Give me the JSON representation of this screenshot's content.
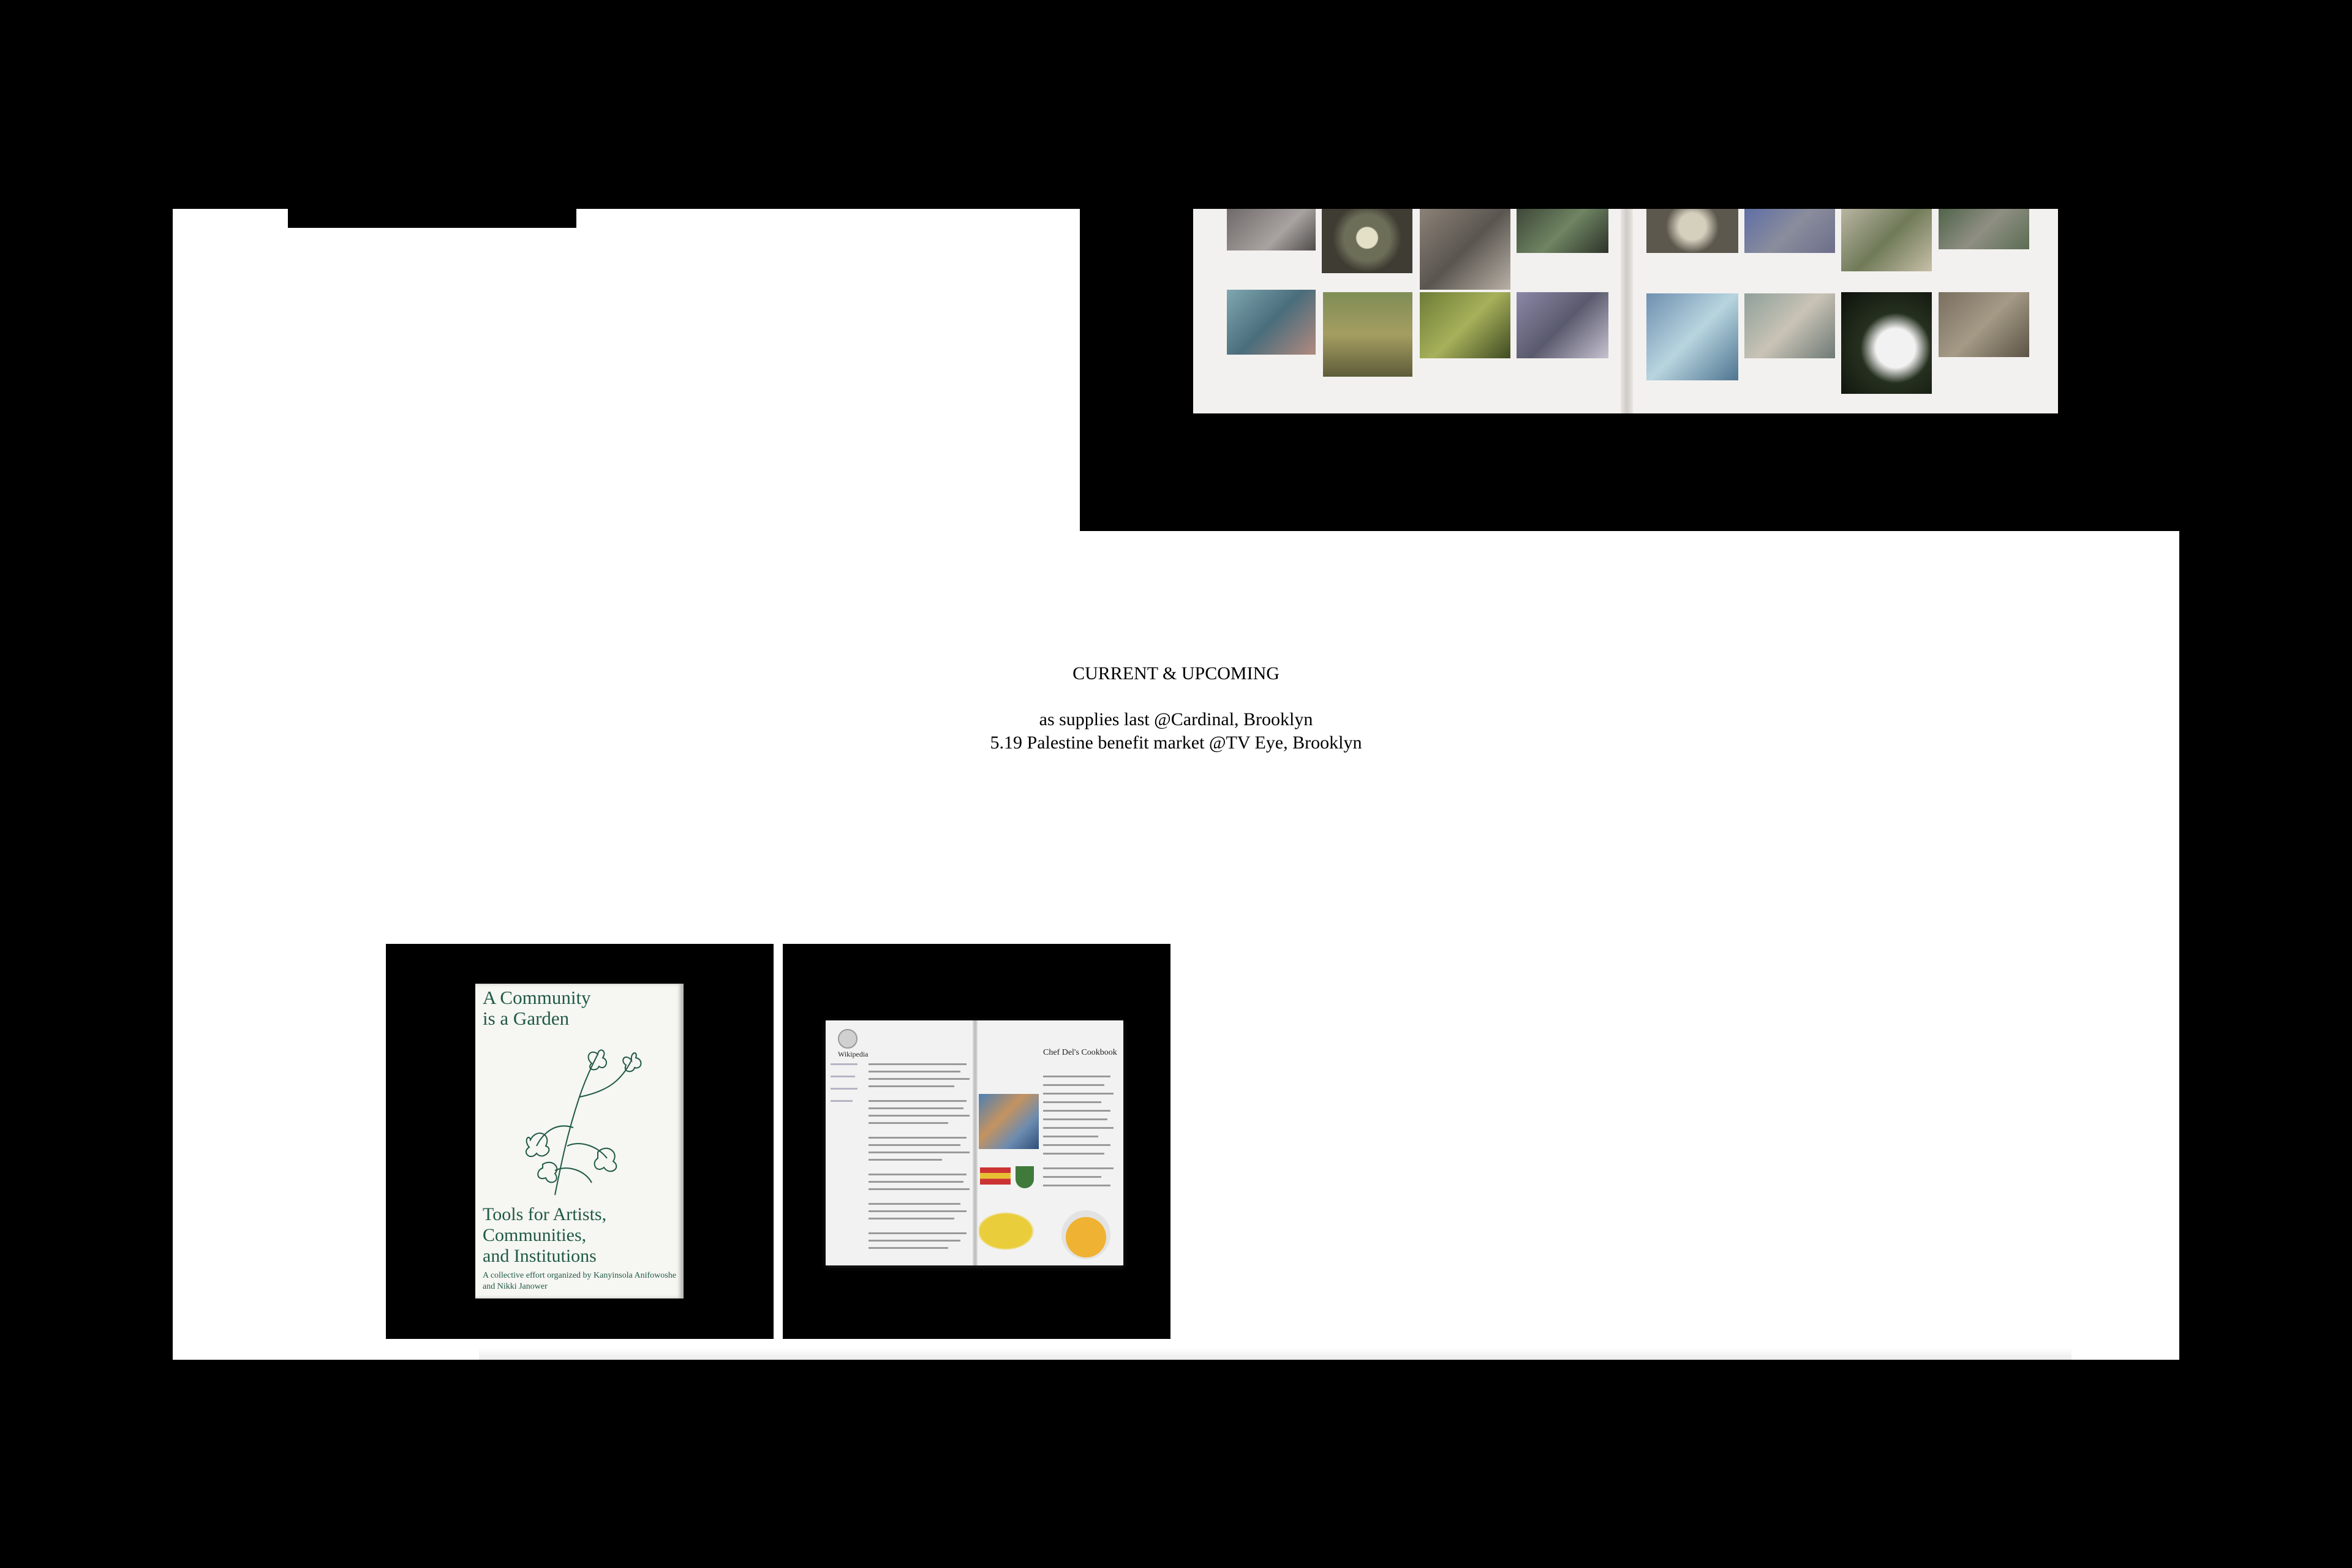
{
  "events": {
    "heading": "CURRENT & UPCOMING",
    "items": [
      "as supplies last @Cardinal, Brooklyn",
      "5.19 Palestine benefit market @TV Eye, Brooklyn"
    ]
  },
  "products": [
    {
      "image": "book-cover",
      "title_line_1": "A Community",
      "title_line_2": "is a Garden",
      "subtitle_line_1": "Tools for Artists,",
      "subtitle_line_2": "Communities,",
      "subtitle_line_3": "and Institutions",
      "credit": "A collective effort organized by Kanyinsola Anifowoshe and Nikki Janower"
    },
    {
      "image": "open-spread",
      "page_heading_left": "Wikipedia",
      "page_heading_right": "Chef Del's Cookbook"
    }
  ],
  "colors": {
    "background": "#000000",
    "page": "#ffffff",
    "book_ink": "#1f5a44"
  },
  "icons": {
    "hero": "mineral-photo-spread-image",
    "logo": "black-logo-bar"
  }
}
